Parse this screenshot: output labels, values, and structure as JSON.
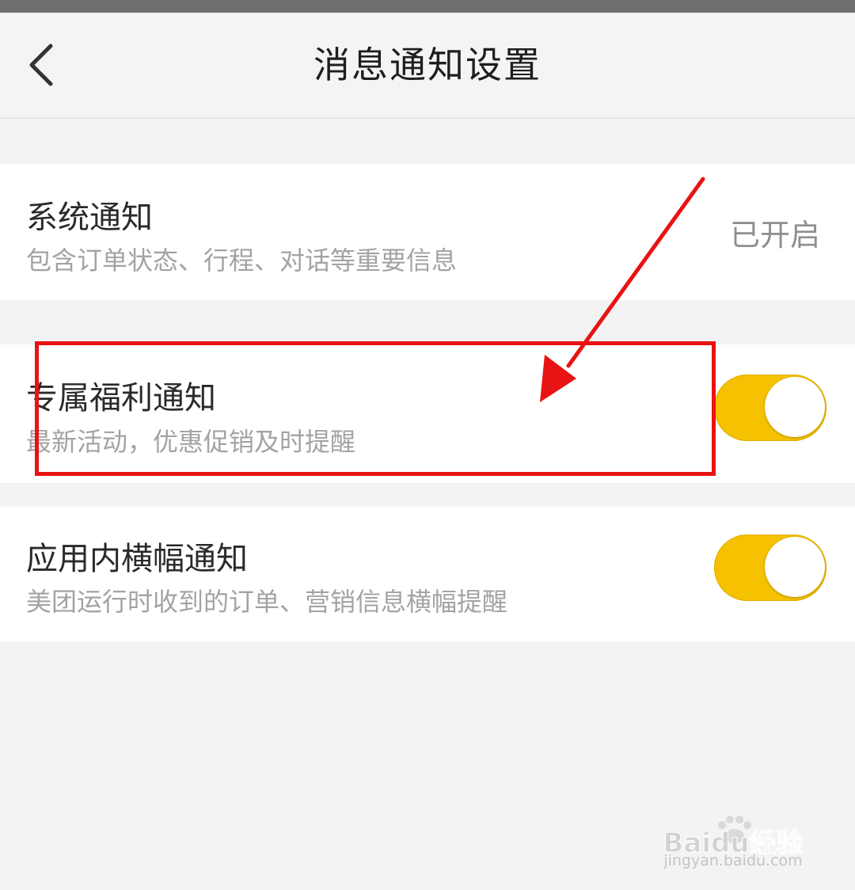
{
  "header": {
    "title": "消息通知设置",
    "back_icon": "chevron-left-icon"
  },
  "settings": [
    {
      "title": "系统通知",
      "description": "包含订单状态、行程、对话等重要信息",
      "status": "已开启"
    },
    {
      "title": "专属福利通知",
      "description": "最新活动，优惠促销及时提醒",
      "toggle": "on"
    },
    {
      "title": "应用内横幅通知",
      "description": "美团运行时收到的订单、营销信息横幅提醒",
      "toggle": "on"
    }
  ],
  "colors": {
    "toggle_on": "#f5c100",
    "annotation": "#e81313",
    "background": "#f3f3f3",
    "row": "#ffffff"
  },
  "watermark": {
    "logo_text": "Baidu经验",
    "url": "jingyan.baidu.com"
  }
}
